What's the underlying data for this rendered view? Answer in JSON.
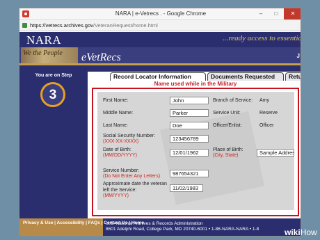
{
  "window": {
    "title": "NARA | e-Vetrecs . - Google Chrome",
    "controls": {
      "minimize": "–",
      "maximize": "□",
      "close": "✕"
    }
  },
  "address_bar": {
    "host": "https://vetrecs.archives.gov",
    "path": "/VeteranRequest/home.html"
  },
  "header": {
    "logo": "NARA",
    "tagline": "...ready access to essentia",
    "scroll_text": "We the People",
    "app_name": "eVetRecs",
    "user_initial": "J"
  },
  "step": {
    "label": "You are on Step",
    "number": "3"
  },
  "tabs": [
    {
      "label": "Record Locator Information",
      "active": true
    },
    {
      "label": "Documents Requested",
      "active": false
    },
    {
      "label": "Return A",
      "active": false
    }
  ],
  "section_title": "Name used while in the Military",
  "form": {
    "first_name": {
      "label": "First Name:",
      "value": "John"
    },
    "middle_name": {
      "label": "Middle Name:",
      "value": "Parker"
    },
    "last_name": {
      "label": "Last Name:",
      "value": "Doe"
    },
    "ssn": {
      "label": "Social Security Number:",
      "hint": "(XXX-XX-XXXX)",
      "value": "123456789"
    },
    "dob": {
      "label": "Date of Birth:",
      "hint": "(MM/DD/YYYY)",
      "value": "12/01/1962"
    },
    "branch": {
      "label": "Branch of Service:",
      "value": "Amy"
    },
    "unit": {
      "label": "Service Unit:",
      "value": "Reserve"
    },
    "officer": {
      "label": "Officer/Enlist:",
      "value": "Officer"
    },
    "pob": {
      "label": "Place of Birth:",
      "hint": "(City, State)",
      "value": "Sample Address"
    },
    "service_number": {
      "label": "Service Number:",
      "hint": "(Do Not Enter Any Letters)",
      "value": "987654321"
    },
    "left_service": {
      "label": "Approximate date the veteran left the Service:",
      "hint": "(MM/YYYY)",
      "value": "11/02/1983"
    }
  },
  "footer": {
    "links": "Privacy & Use | Accessibility | FAQs | Contact Us | Home",
    "line1": "U.S. National Archives & Records Administration",
    "line2": "8601 Adelphi Road, College Park, MD 20740-6001 • 1-86-NARA-NARA • 1-8"
  },
  "watermark": {
    "wiki": "wiki",
    "how": "How"
  },
  "colors": {
    "nara_navy": "#2b2e6e",
    "accent_red": "#c7131d",
    "step_orange": "#e9a020",
    "gold": "#c7a04d"
  }
}
